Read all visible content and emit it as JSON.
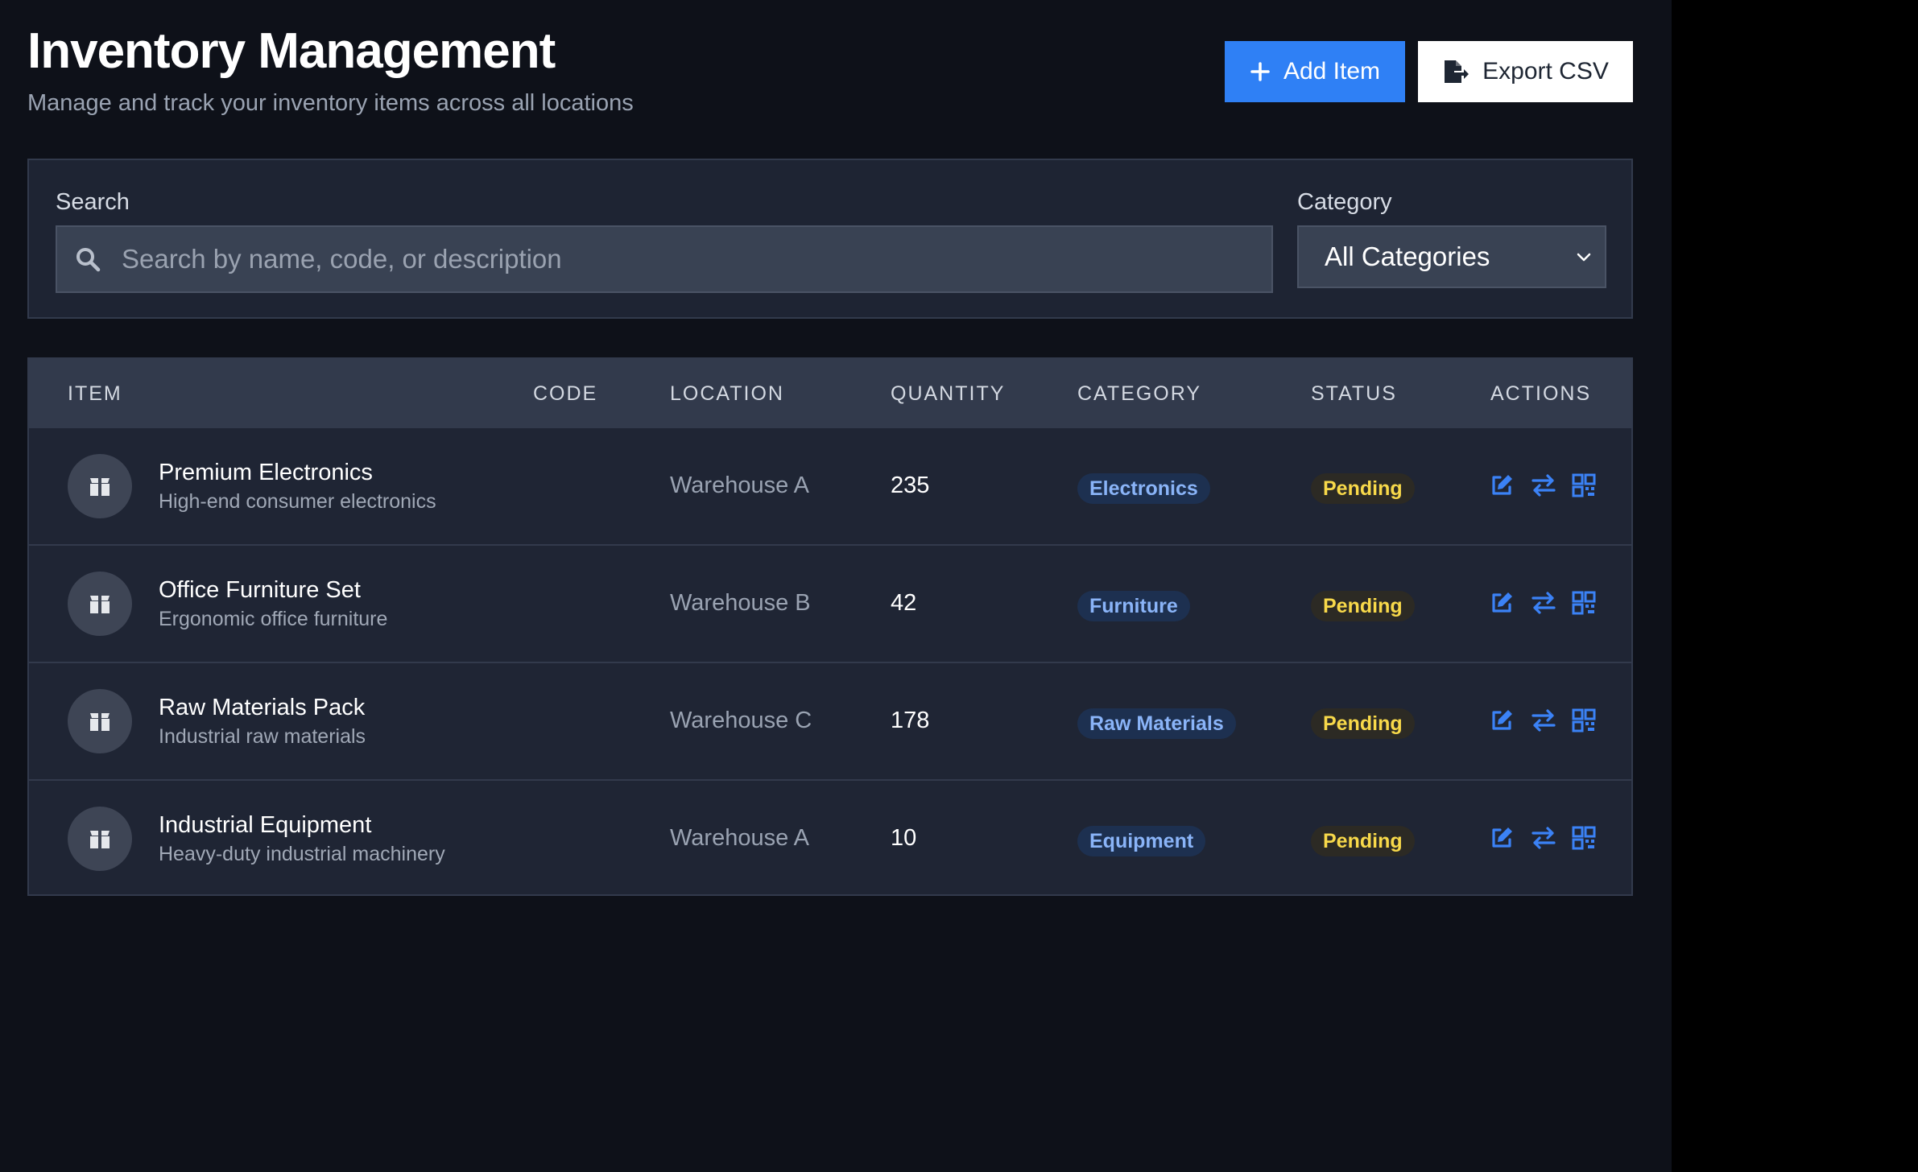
{
  "header": {
    "title": "Inventory Management",
    "subtitle": "Manage and track your inventory items across all locations",
    "add_label": "Add Item",
    "export_label": "Export CSV"
  },
  "filters": {
    "search_label": "Search",
    "search_placeholder": "Search by name, code, or description",
    "search_value": "",
    "category_label": "Category",
    "category_value": "All Categories"
  },
  "table": {
    "columns": [
      "ITEM",
      "CODE",
      "LOCATION",
      "QUANTITY",
      "CATEGORY",
      "STATUS",
      "ACTIONS"
    ],
    "rows": [
      {
        "name": "Premium Electronics",
        "description": "High-end consumer electronics",
        "code": "",
        "location": "Warehouse A",
        "quantity": "235",
        "category": "Electronics",
        "status": "Pending"
      },
      {
        "name": "Office Furniture Set",
        "description": "Ergonomic office furniture",
        "code": "",
        "location": "Warehouse B",
        "quantity": "42",
        "category": "Furniture",
        "status": "Pending"
      },
      {
        "name": "Raw Materials Pack",
        "description": "Industrial raw materials",
        "code": "",
        "location": "Warehouse C",
        "quantity": "178",
        "category": "Raw Materials",
        "status": "Pending"
      },
      {
        "name": "Industrial Equipment",
        "description": "Heavy-duty industrial machinery",
        "code": "",
        "location": "Warehouse A",
        "quantity": "10",
        "category": "Equipment",
        "status": "Pending"
      }
    ]
  },
  "icons": {
    "add": "plus-icon",
    "export": "file-export-icon",
    "search": "search-icon",
    "dropdown": "chevron-down-icon",
    "item": "box-icon",
    "edit": "edit-icon",
    "transfer": "transfer-icon",
    "qr": "qr-code-icon"
  },
  "colors": {
    "accent": "#2f80f5",
    "background": "#0e1119",
    "panel": "#1f2534",
    "category_badge_text": "#8ab4f8",
    "status_pending_text": "#f8d94a",
    "action_icon": "#3b82f6"
  }
}
